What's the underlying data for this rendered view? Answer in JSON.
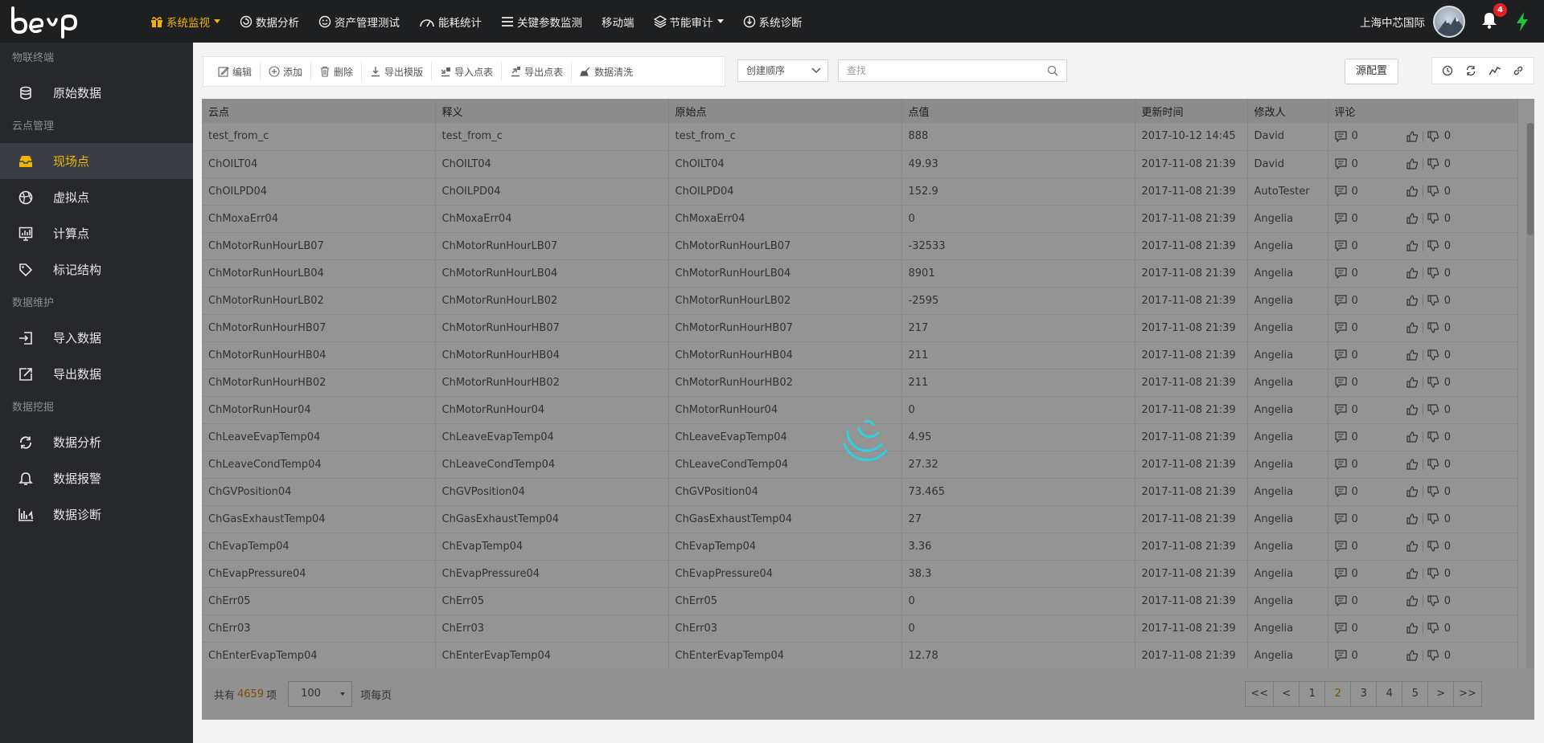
{
  "header": {
    "nav": [
      {
        "label": "系统监视",
        "icon": "gift-icon",
        "active": true,
        "dropdown": true
      },
      {
        "label": "数据分析",
        "icon": "refresh-circle-icon"
      },
      {
        "label": "资产管理测试",
        "icon": "smiley-icon"
      },
      {
        "label": "能耗统计",
        "icon": "gauge-icon"
      },
      {
        "label": "关键参数监测",
        "icon": "list-icon"
      },
      {
        "label": "移动端",
        "icon": ""
      },
      {
        "label": "节能审计",
        "icon": "layers-icon",
        "dropdown": true
      },
      {
        "label": "系统诊断",
        "icon": "download-circle-icon"
      }
    ],
    "company": "上海中芯国际",
    "notifications": "4"
  },
  "sidebar": [
    {
      "type": "section",
      "label": "物联终端"
    },
    {
      "type": "item",
      "label": "原始数据",
      "icon": "database-icon"
    },
    {
      "type": "section",
      "label": "云点管理"
    },
    {
      "type": "item",
      "label": "现场点",
      "icon": "inbox-icon",
      "active": true
    },
    {
      "type": "item",
      "label": "虚拟点",
      "icon": "basketball-icon"
    },
    {
      "type": "item",
      "label": "计算点",
      "icon": "chart-board-icon"
    },
    {
      "type": "item",
      "label": "标记结构",
      "icon": "tag-icon"
    },
    {
      "type": "section",
      "label": "数据维护"
    },
    {
      "type": "item",
      "label": "导入数据",
      "icon": "import-icon"
    },
    {
      "type": "item",
      "label": "导出数据",
      "icon": "export-icon"
    },
    {
      "type": "section",
      "label": "数据挖掘"
    },
    {
      "type": "item",
      "label": "数据分析",
      "icon": "cycle-icon"
    },
    {
      "type": "item",
      "label": "数据报警",
      "icon": "alarm-bell-icon"
    },
    {
      "type": "item",
      "label": "数据诊断",
      "icon": "diagnosis-chart-icon"
    }
  ],
  "toolbar": {
    "buttons": [
      {
        "label": "编辑",
        "icon": "edit-icon"
      },
      {
        "label": "添加",
        "icon": "add-circle-icon"
      },
      {
        "label": "删除",
        "icon": "trash-icon"
      },
      {
        "label": "导出模版",
        "icon": "download-icon"
      },
      {
        "label": "导入点表",
        "icon": "import-table-icon"
      },
      {
        "label": "导出点表",
        "icon": "export-table-icon"
      },
      {
        "label": "数据清洗",
        "icon": "clean-icon"
      }
    ],
    "sort_value": "创建顺序",
    "search_placeholder": "查找",
    "source_config": "源配置",
    "right_icons": [
      "clock-icon",
      "sync-icon",
      "trend-icon",
      "link-icon"
    ]
  },
  "table": {
    "columns": [
      "云点",
      "释义",
      "原始点",
      "点值",
      "更新时间",
      "修改人",
      "评论"
    ],
    "rows": [
      [
        "test_from_c",
        "test_from_c",
        "test_from_c",
        "888",
        "2017-10-12 14:45",
        "David",
        "0",
        "0"
      ],
      [
        "ChOILT04",
        "ChOILT04",
        "ChOILT04",
        "49.93",
        "2017-11-08 21:39",
        "David",
        "0",
        "0"
      ],
      [
        "ChOILPD04",
        "ChOILPD04",
        "ChOILPD04",
        "152.9",
        "2017-11-08 21:39",
        "AutoTester",
        "0",
        "0"
      ],
      [
        "ChMoxaErr04",
        "ChMoxaErr04",
        "ChMoxaErr04",
        "0",
        "2017-11-08 21:39",
        "Angelia",
        "0",
        "0"
      ],
      [
        "ChMotorRunHourLB07",
        "ChMotorRunHourLB07",
        "ChMotorRunHourLB07",
        "-32533",
        "2017-11-08 21:39",
        "Angelia",
        "0",
        "0"
      ],
      [
        "ChMotorRunHourLB04",
        "ChMotorRunHourLB04",
        "ChMotorRunHourLB04",
        "8901",
        "2017-11-08 21:39",
        "Angelia",
        "0",
        "0"
      ],
      [
        "ChMotorRunHourLB02",
        "ChMotorRunHourLB02",
        "ChMotorRunHourLB02",
        "-2595",
        "2017-11-08 21:39",
        "Angelia",
        "0",
        "0"
      ],
      [
        "ChMotorRunHourHB07",
        "ChMotorRunHourHB07",
        "ChMotorRunHourHB07",
        "217",
        "2017-11-08 21:39",
        "Angelia",
        "0",
        "0"
      ],
      [
        "ChMotorRunHourHB04",
        "ChMotorRunHourHB04",
        "ChMotorRunHourHB04",
        "211",
        "2017-11-08 21:39",
        "Angelia",
        "0",
        "0"
      ],
      [
        "ChMotorRunHourHB02",
        "ChMotorRunHourHB02",
        "ChMotorRunHourHB02",
        "211",
        "2017-11-08 21:39",
        "Angelia",
        "0",
        "0"
      ],
      [
        "ChMotorRunHour04",
        "ChMotorRunHour04",
        "ChMotorRunHour04",
        "0",
        "2017-11-08 21:39",
        "Angelia",
        "0",
        "0"
      ],
      [
        "ChLeaveEvapTemp04",
        "ChLeaveEvapTemp04",
        "ChLeaveEvapTemp04",
        "4.95",
        "2017-11-08 21:39",
        "Angelia",
        "0",
        "0"
      ],
      [
        "ChLeaveCondTemp04",
        "ChLeaveCondTemp04",
        "ChLeaveCondTemp04",
        "27.32",
        "2017-11-08 21:39",
        "Angelia",
        "0",
        "0"
      ],
      [
        "ChGVPosition04",
        "ChGVPosition04",
        "ChGVPosition04",
        "73.465",
        "2017-11-08 21:39",
        "Angelia",
        "0",
        "0"
      ],
      [
        "ChGasExhaustTemp04",
        "ChGasExhaustTemp04",
        "ChGasExhaustTemp04",
        "27",
        "2017-11-08 21:39",
        "Angelia",
        "0",
        "0"
      ],
      [
        "ChEvapTemp04",
        "ChEvapTemp04",
        "ChEvapTemp04",
        "3.36",
        "2017-11-08 21:39",
        "Angelia",
        "0",
        "0"
      ],
      [
        "ChEvapPressure04",
        "ChEvapPressure04",
        "ChEvapPressure04",
        "38.3",
        "2017-11-08 21:39",
        "Angelia",
        "0",
        "0"
      ],
      [
        "ChErr05",
        "ChErr05",
        "ChErr05",
        "0",
        "2017-11-08 21:39",
        "Angelia",
        "0",
        "0"
      ],
      [
        "ChErr03",
        "ChErr03",
        "ChErr03",
        "0",
        "2017-11-08 21:39",
        "Angelia",
        "0",
        "0"
      ],
      [
        "ChEnterEvapTemp04",
        "ChEnterEvapTemp04",
        "ChEnterEvapTemp04",
        "12.78",
        "2017-11-08 21:39",
        "Angelia",
        "0",
        "0"
      ]
    ]
  },
  "footer": {
    "total_prefix": "共有",
    "total": "4659",
    "total_suffix": "项",
    "per_page": "100",
    "per_page_suffix": "项每页",
    "pages": [
      "<<",
      "<",
      "1",
      "2",
      "3",
      "4",
      "5",
      ">",
      ">>"
    ],
    "current_page": "2"
  },
  "colors": {
    "accent": "#f0b400",
    "topbar": "#1e1f21",
    "sidebar": "#26282c",
    "spinner": "#2fd0e0"
  }
}
